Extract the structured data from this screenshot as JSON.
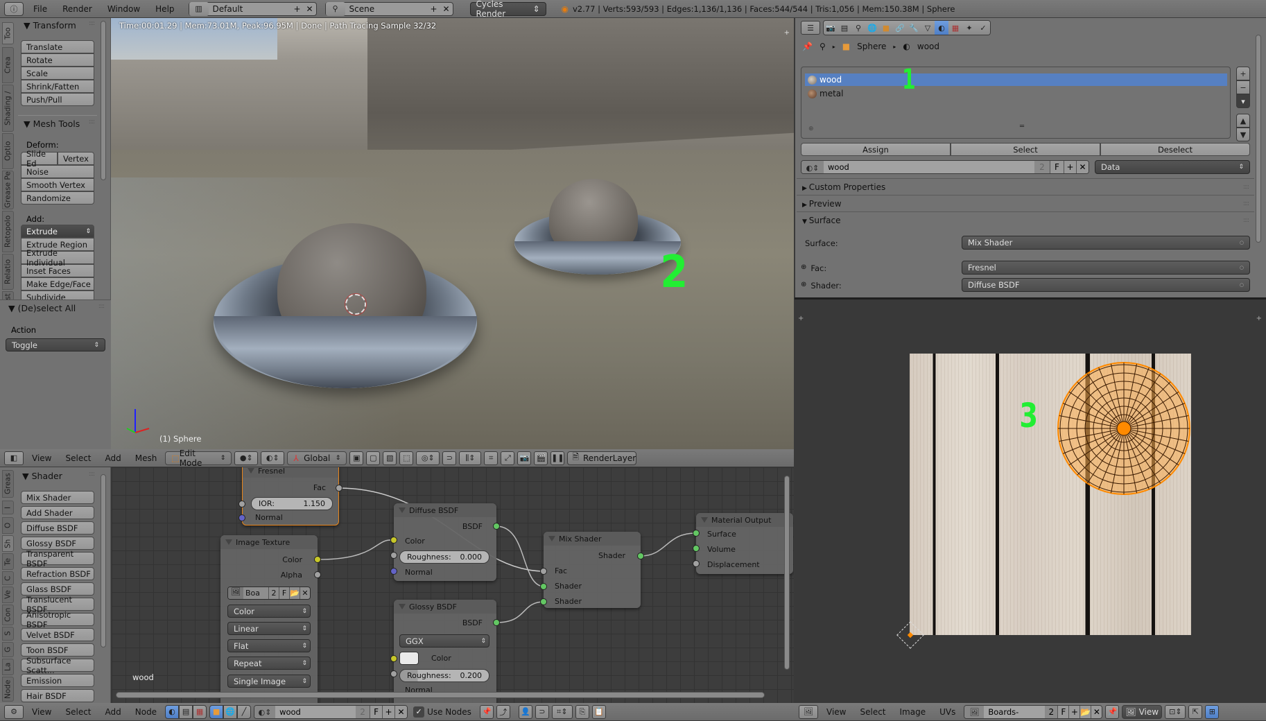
{
  "topbar": {
    "menus": [
      "File",
      "Render",
      "Window",
      "Help"
    ],
    "layout": "Default",
    "scene": "Scene",
    "engine": "Cycles Render",
    "stats": "v2.77 | Verts:593/593 | Edges:1,136/1,136 | Faces:544/544 | Tris:1,056 | Mem:150.38M | Sphere"
  },
  "toolshelf": {
    "tabs": [
      "Too",
      "Crea",
      "Shading /",
      "Optio",
      "Grease Pe",
      "Retopolo",
      "Relatio",
      "Avast"
    ],
    "transform_title": "Transform",
    "transform_buttons": [
      "Translate",
      "Rotate",
      "Scale",
      "Shrink/Fatten",
      "Push/Pull"
    ],
    "mesh_tools_title": "Mesh Tools",
    "deform_label": "Deform:",
    "deform_row": [
      "Slide Ed",
      "Vertex"
    ],
    "deform_buttons": [
      "Noise",
      "Smooth Vertex",
      "Randomize"
    ],
    "add_label": "Add:",
    "extrude_select": "Extrude",
    "add_buttons": [
      "Extrude Region",
      "Extrude Individual",
      "Inset Faces",
      "Make Edge/Face",
      "Subdivide"
    ],
    "operator_title": "(De)select All",
    "action_label": "Action",
    "action_value": "Toggle"
  },
  "viewport": {
    "render_info": "Time:00:01.29 | Mem:73.01M, Peak:96.95M | Done | Path Tracing Sample 32/32",
    "object_label": "(1) Sphere",
    "annotation": "2",
    "header": {
      "menus": [
        "View",
        "Select",
        "Add",
        "Mesh"
      ],
      "mode": "Edit Mode",
      "orientation": "Global",
      "render_layer": "RenderLayer"
    }
  },
  "properties": {
    "breadcrumb": [
      "Sphere",
      "wood"
    ],
    "material_slots": [
      {
        "name": "wood",
        "selected": true
      },
      {
        "name": "metal",
        "selected": false
      }
    ],
    "annotation": "1",
    "slot_buttons": [
      "Assign",
      "Select",
      "Deselect"
    ],
    "material_name": "wood",
    "users": "2",
    "fake_user": "F",
    "link": "Data",
    "panels": [
      "Custom Properties",
      "Preview",
      "Surface"
    ],
    "surface_label": "Surface:",
    "surface_value": "Mix Shader",
    "fac_label": "Fac:",
    "fac_value": "Fresnel",
    "shader_label": "Shader:",
    "shader_value": "Diffuse BSDF"
  },
  "node_editor": {
    "tabs": [
      "Greas",
      "I",
      "O",
      "Sh",
      "Te",
      "C",
      "Ve",
      "Con",
      "S",
      "G",
      "La",
      "Node"
    ],
    "shelf_title": "Shader",
    "shelf_buttons": [
      "Mix Shader",
      "Add Shader",
      "Diffuse BSDF",
      "Glossy BSDF",
      "Transparent BSDF",
      "Refraction BSDF",
      "Glass BSDF",
      "Translucent BSDF",
      "Anisotropic BSDF",
      "Velvet BSDF",
      "Toon BSDF",
      "Subsurface Scatt...",
      "Emission",
      "Hair BSDF"
    ],
    "material_label": "wood",
    "nodes": {
      "fresnel": {
        "title": "Fresnel",
        "out": "Fac",
        "ior_label": "IOR:",
        "ior_value": "1.150",
        "normal": "Normal"
      },
      "image_texture": {
        "title": "Image Texture",
        "out_color": "Color",
        "out_alpha": "Alpha",
        "image": "Boa",
        "users": "2",
        "fake": "F",
        "color_space": "Color",
        "interpolation": "Linear",
        "projection": "Flat",
        "extension": "Repeat",
        "source": "Single Image"
      },
      "diffuse": {
        "title": "Diffuse BSDF",
        "out": "BSDF",
        "color": "Color",
        "roughness_label": "Roughness:",
        "roughness_value": "0.000",
        "normal": "Normal"
      },
      "glossy": {
        "title": "Glossy BSDF",
        "out": "BSDF",
        "distribution": "GGX",
        "color": "Color",
        "roughness_label": "Roughness:",
        "roughness_value": "0.200",
        "normal": "Normal"
      },
      "mix": {
        "title": "Mix Shader",
        "out": "Shader",
        "fac": "Fac",
        "shader1": "Shader",
        "shader2": "Shader"
      },
      "output": {
        "title": "Material Output",
        "surface": "Surface",
        "volume": "Volume",
        "displacement": "Displacement"
      }
    },
    "header": {
      "menus": [
        "View",
        "Select",
        "Add",
        "Node"
      ],
      "material": "wood",
      "users": "2",
      "fake": "F",
      "use_nodes_label": "Use Nodes",
      "use_nodes": true
    }
  },
  "uv_editor": {
    "annotation": "3",
    "header": {
      "menus": [
        "View",
        "Select",
        "Image",
        "UVs"
      ],
      "image": "Boards-New.jpg",
      "users": "2",
      "fake": "F",
      "view": "View"
    }
  },
  "colors": {
    "accent": "#5680c2",
    "annotation_green": "#22ee33",
    "uv_orange": "#ff8a00"
  }
}
